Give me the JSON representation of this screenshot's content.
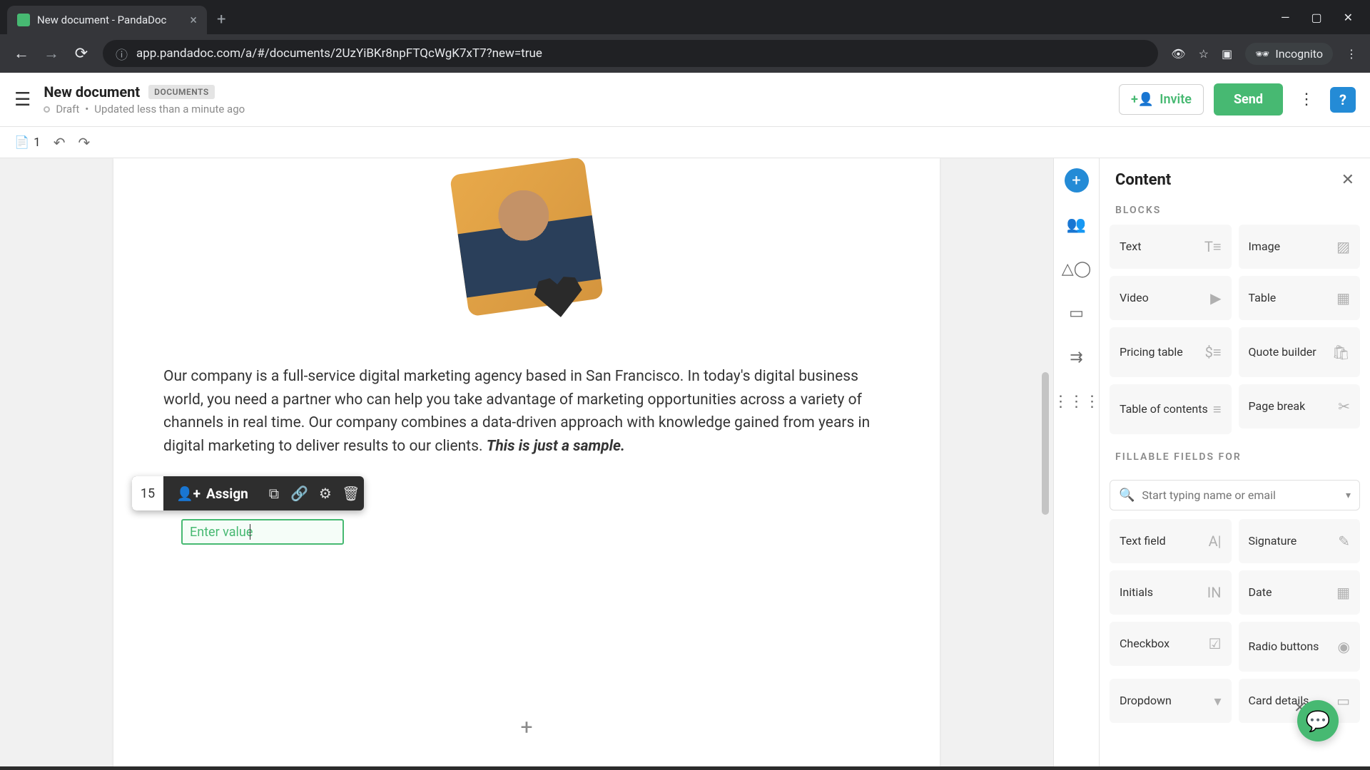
{
  "browser": {
    "tab_title": "New document - PandaDoc",
    "url": "app.pandadoc.com/a/#/documents/2UzYiBKr8npFTQcWgK7xT7?new=true",
    "incognito_label": "Incognito"
  },
  "header": {
    "title": "New document",
    "badge": "DOCUMENTS",
    "status_state": "Draft",
    "status_updated": "Updated less than a minute ago",
    "invite_label": "Invite",
    "send_label": "Send",
    "help_label": "?"
  },
  "toolbar": {
    "page_count": "1"
  },
  "document": {
    "body_text": "Our company is a full-service digital marketing agency based in San Francisco. In today's digital business world, you need a partner who can help you take advantage of marketing opportunities across a variety of channels in real time. Our company combines a data-driven approach with knowledge gained from years in digital marketing to deliver results to our clients. ",
    "sample_text": "This is just a sample.",
    "field_toolbar": {
      "font_size": "15",
      "assign_label": "Assign"
    },
    "fillable_placeholder": "Enter value"
  },
  "content_panel": {
    "title": "Content",
    "blocks_label": "BLOCKS",
    "blocks": [
      {
        "label": "Text",
        "icon": "text-icon"
      },
      {
        "label": "Image",
        "icon": "image-icon"
      },
      {
        "label": "Video",
        "icon": "video-icon"
      },
      {
        "label": "Table",
        "icon": "table-icon"
      },
      {
        "label": "Pricing table",
        "icon": "pricing-icon"
      },
      {
        "label": "Quote builder",
        "icon": "quote-icon"
      },
      {
        "label": "Table of contents",
        "icon": "toc-icon"
      },
      {
        "label": "Page break",
        "icon": "break-icon"
      }
    ],
    "fillable_label": "FILLABLE FIELDS FOR",
    "recipient_placeholder": "Start typing name or email",
    "fields": [
      {
        "label": "Text field",
        "icon": "A|"
      },
      {
        "label": "Signature",
        "icon": "✎"
      },
      {
        "label": "Initials",
        "icon": "IN"
      },
      {
        "label": "Date",
        "icon": "▦"
      },
      {
        "label": "Checkbox",
        "icon": "☑"
      },
      {
        "label": "Radio buttons",
        "icon": "◉"
      },
      {
        "label": "Dropdown",
        "icon": "▾"
      },
      {
        "label": "Card details",
        "icon": "▭"
      }
    ]
  }
}
